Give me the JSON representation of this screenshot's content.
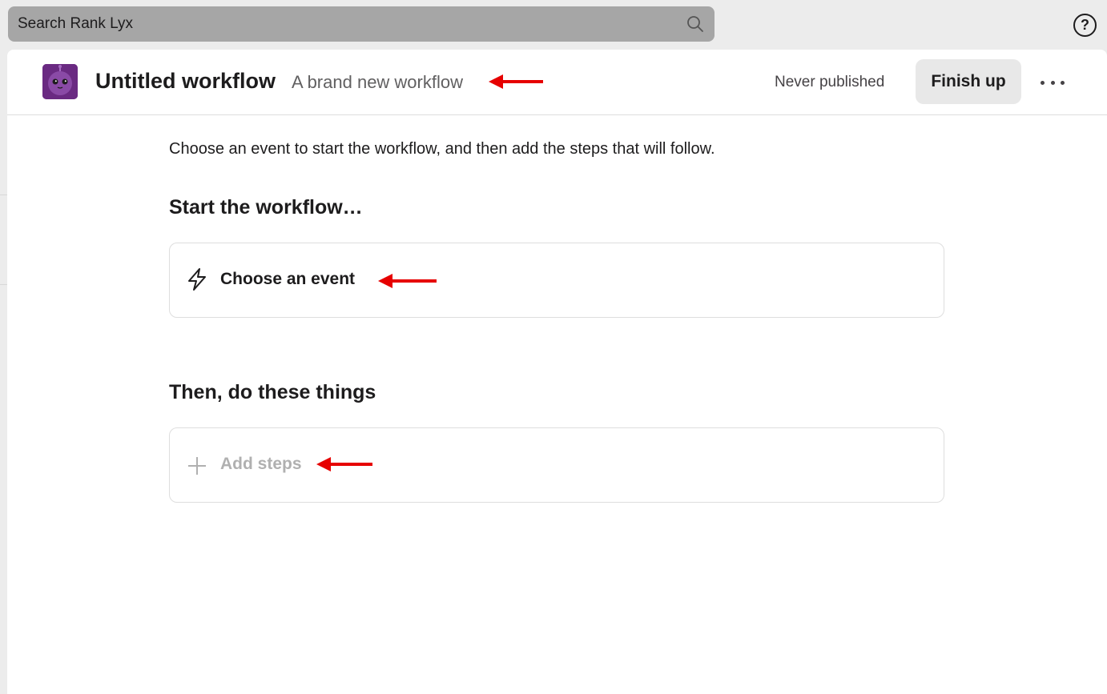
{
  "search": {
    "placeholder": "Search Rank Lyx"
  },
  "header": {
    "title": "Untitled workflow",
    "subtitle": "A brand new workflow",
    "publish_status": "Never published",
    "finish_label": "Finish up"
  },
  "main": {
    "intro": "Choose an event to start the workflow, and then add the steps that will follow.",
    "start_section": {
      "title": "Start the workflow…",
      "action_label": "Choose an event"
    },
    "steps_section": {
      "title": "Then, do these things",
      "action_label": "Add steps"
    }
  },
  "colors": {
    "accent_avatar": "#6a2a82",
    "annotation_arrow": "#e60000",
    "muted_text": "#b0b0b0"
  },
  "icons": [
    "search-icon",
    "help-icon",
    "workflow-avatar-icon",
    "more-icon",
    "lightning-icon",
    "plus-icon",
    "arrow-icon"
  ]
}
